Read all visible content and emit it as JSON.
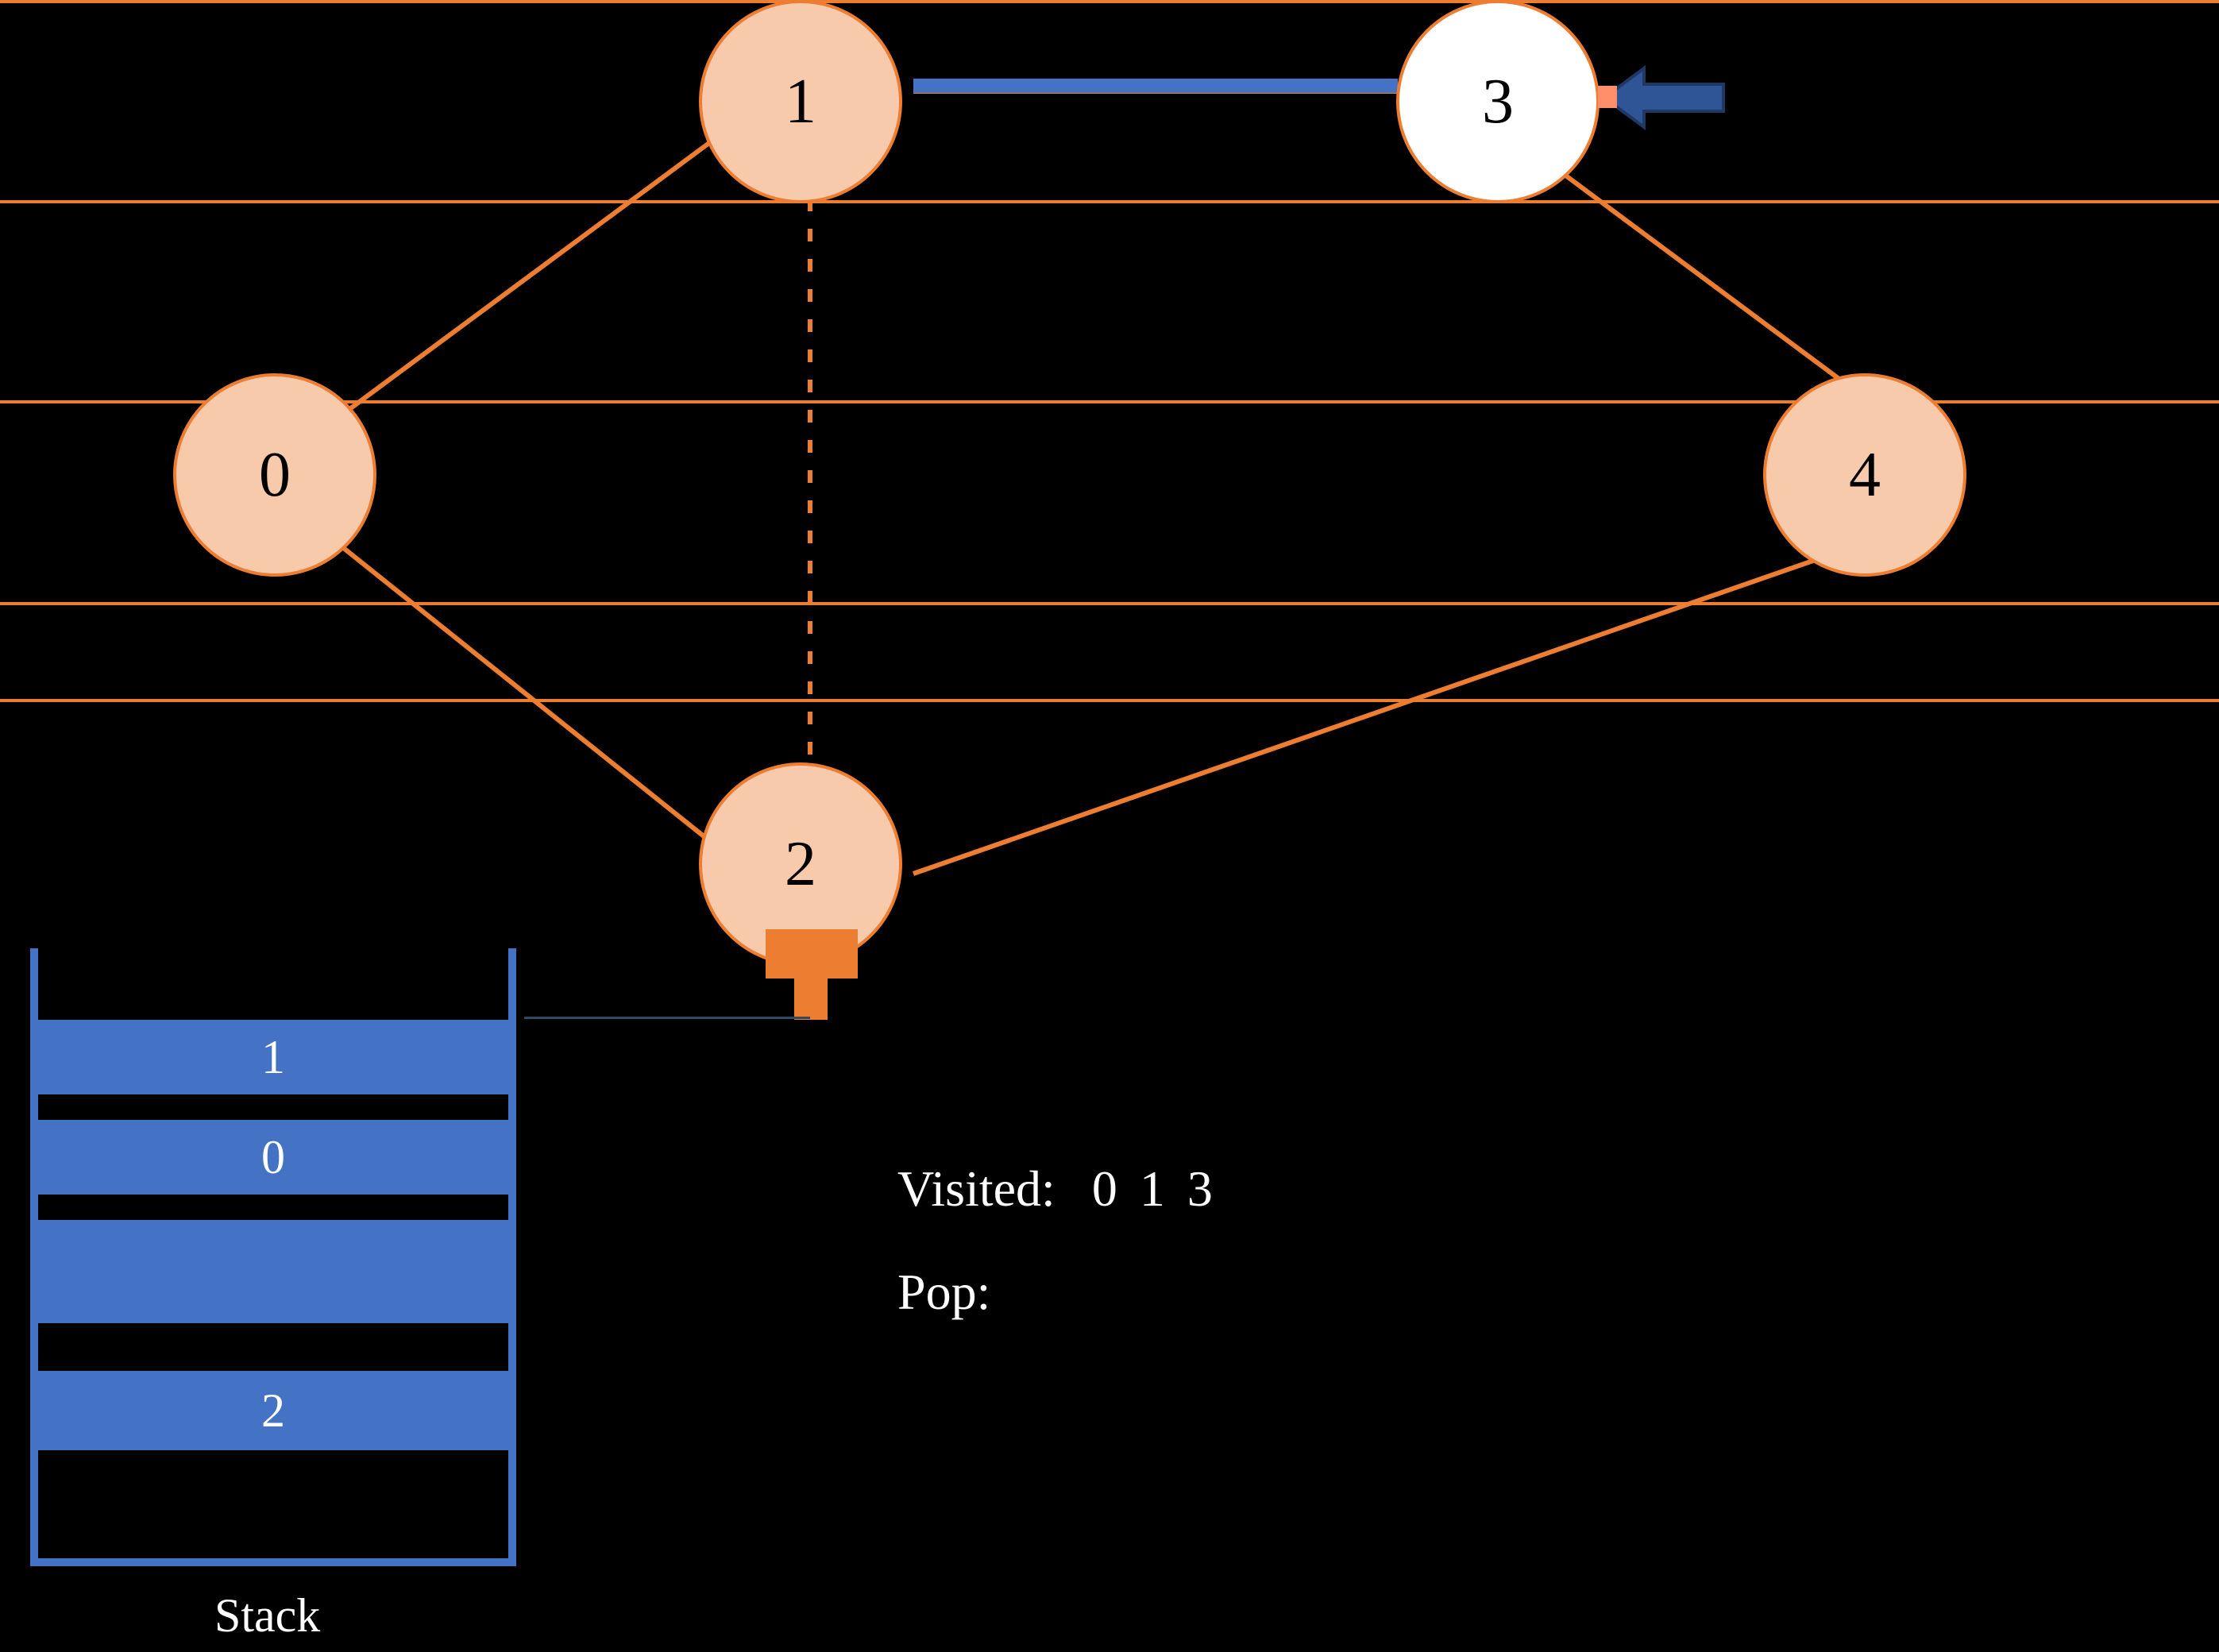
{
  "nodes": {
    "n0": "0",
    "n1": "1",
    "n2": "2",
    "n3": "3",
    "n4": "4"
  },
  "stack": {
    "label": "Stack",
    "rows": [
      "1",
      "0",
      "2"
    ]
  },
  "visited": {
    "label": "Visited:",
    "order": "0  1   3"
  },
  "pop": {
    "label": "Pop:",
    "value": ""
  },
  "current_node": "3",
  "edges": [
    {
      "from": "0",
      "to": "1"
    },
    {
      "from": "0",
      "to": "2"
    },
    {
      "from": "1",
      "to": "2",
      "style": "dashed"
    },
    {
      "from": "1",
      "to": "3",
      "style": "thick"
    },
    {
      "from": "2",
      "to": "4"
    },
    {
      "from": "3",
      "to": "4"
    }
  ],
  "colors": {
    "node_fill": "#f7caac",
    "node_border": "#ed7d31",
    "edge": "#ed7d31",
    "highlight_edge": "#4472c4",
    "stack_blue": "#4472c4",
    "pointer_blue": "#2f5597"
  }
}
